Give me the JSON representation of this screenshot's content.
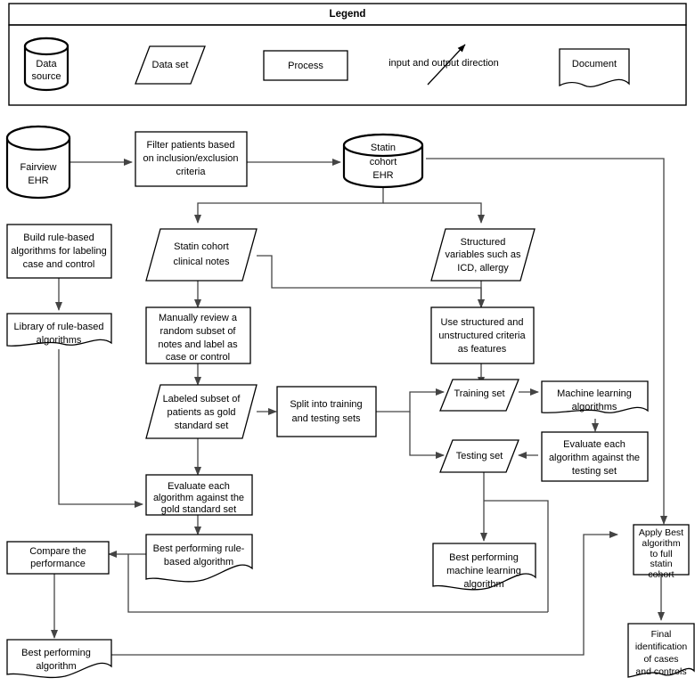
{
  "legend": {
    "title": "Legend",
    "items": [
      {
        "shape": "cylinder",
        "lines": [
          "Data",
          "source"
        ]
      },
      {
        "shape": "parallelogram",
        "lines": [
          "Data set"
        ]
      },
      {
        "shape": "rectangle",
        "lines": [
          "Process"
        ]
      },
      {
        "shape": "arrow",
        "lines": [
          "input and output direction"
        ]
      },
      {
        "shape": "document",
        "lines": [
          "Document"
        ]
      }
    ]
  },
  "flowchart": {
    "nodes": {
      "fairview_ehr": {
        "type": "cylinder",
        "lines": [
          "Fairview",
          "EHR"
        ]
      },
      "filter_patients": {
        "type": "process",
        "lines": [
          "Filter patients based",
          "on inclusion/exclusion",
          "criteria"
        ]
      },
      "statin_cohort_ehr": {
        "type": "cylinder",
        "lines": [
          "Statin",
          "cohort",
          "EHR"
        ]
      },
      "build_rule_based": {
        "type": "process",
        "lines": [
          "Build rule-based",
          "algorithms for labeling",
          "case and control"
        ]
      },
      "clinical_notes": {
        "type": "parallelogram",
        "lines": [
          "Statin cohort",
          "clinical notes"
        ]
      },
      "structured_vars": {
        "type": "parallelogram",
        "lines": [
          "Structured",
          "variables such as",
          "ICD, allergy"
        ]
      },
      "library_rule_based": {
        "type": "document",
        "lines": [
          "Library of rule-based",
          "algorithms"
        ]
      },
      "manual_review": {
        "type": "process",
        "lines": [
          "Manually review a",
          "random subset of",
          "notes and label as",
          "case or control"
        ]
      },
      "use_criteria": {
        "type": "process",
        "lines": [
          "Use structured and",
          "unstructured criteria",
          "as features"
        ]
      },
      "labeled_subset": {
        "type": "parallelogram",
        "lines": [
          "Labeled subset of",
          "patients as gold",
          "standard set"
        ]
      },
      "split_sets": {
        "type": "process",
        "lines": [
          "Split into training",
          "and testing sets"
        ]
      },
      "training_set": {
        "type": "parallelogram",
        "lines": [
          "Training set"
        ]
      },
      "ml_algorithms": {
        "type": "document",
        "lines": [
          "Machine learning",
          "algorithms"
        ]
      },
      "testing_set": {
        "type": "parallelogram",
        "lines": [
          "Testing set"
        ]
      },
      "evaluate_testing": {
        "type": "process",
        "lines": [
          "Evaluate each",
          "algorithm against the",
          "testing set"
        ]
      },
      "evaluate_gold": {
        "type": "process",
        "lines": [
          "Evaluate each",
          "algorithm against the",
          "gold standard set"
        ]
      },
      "best_rule_based": {
        "type": "document",
        "lines": [
          "Best performing rule-",
          "based algorithm"
        ]
      },
      "compare_performance": {
        "type": "process",
        "lines": [
          "Compare the",
          "performance"
        ]
      },
      "best_ml": {
        "type": "document",
        "lines": [
          "Best performing",
          "machine learning",
          "algorithm"
        ]
      },
      "apply_best": {
        "type": "process",
        "lines": [
          "Apply Best",
          "algorithm",
          "to full",
          "statin",
          "cohort"
        ]
      },
      "best_performing": {
        "type": "document",
        "lines": [
          "Best performing",
          "algorithm"
        ]
      },
      "final_identification": {
        "type": "document",
        "lines": [
          "Final",
          "identification",
          "of cases",
          "and controls"
        ]
      }
    }
  },
  "colors": {
    "stroke": "#000000",
    "connector": "#444444",
    "background": "#ffffff"
  }
}
